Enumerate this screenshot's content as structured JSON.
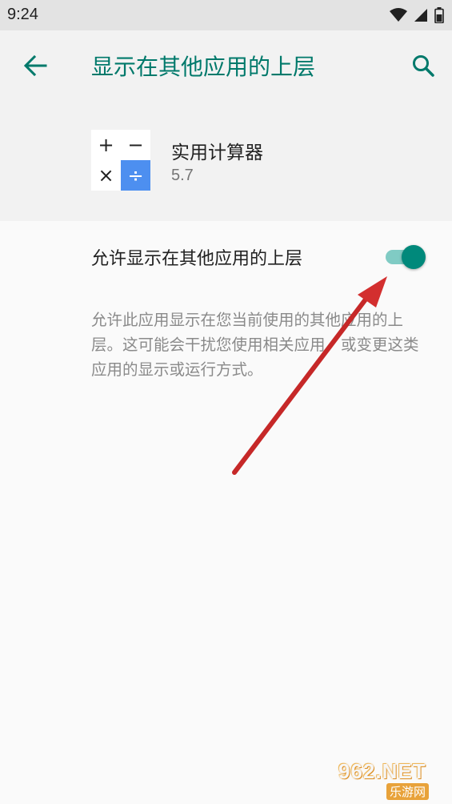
{
  "status_bar": {
    "time": "9:24",
    "icons": [
      "wifi-icon",
      "signal-icon",
      "battery-icon"
    ]
  },
  "app_bar": {
    "title": "显示在其他应用的上层",
    "back_icon": "arrow-back-icon",
    "search_icon": "search-icon",
    "accent_color": "#00796b"
  },
  "app_header": {
    "name": "实用计算器",
    "version": "5.7",
    "icon_symbols": [
      "+",
      "−",
      "×",
      "÷"
    ]
  },
  "permission": {
    "toggle_label": "允许显示在其他应用的上层",
    "toggle_on": true,
    "toggle_color": "#00897b",
    "description": "允许此应用显示在您当前使用的其他应用的上层。这可能会干扰您使用相关应用，或变更这类应用的显示或运行方式。"
  },
  "watermark": {
    "logo": "962.NET",
    "subtitle": "乐游网"
  }
}
